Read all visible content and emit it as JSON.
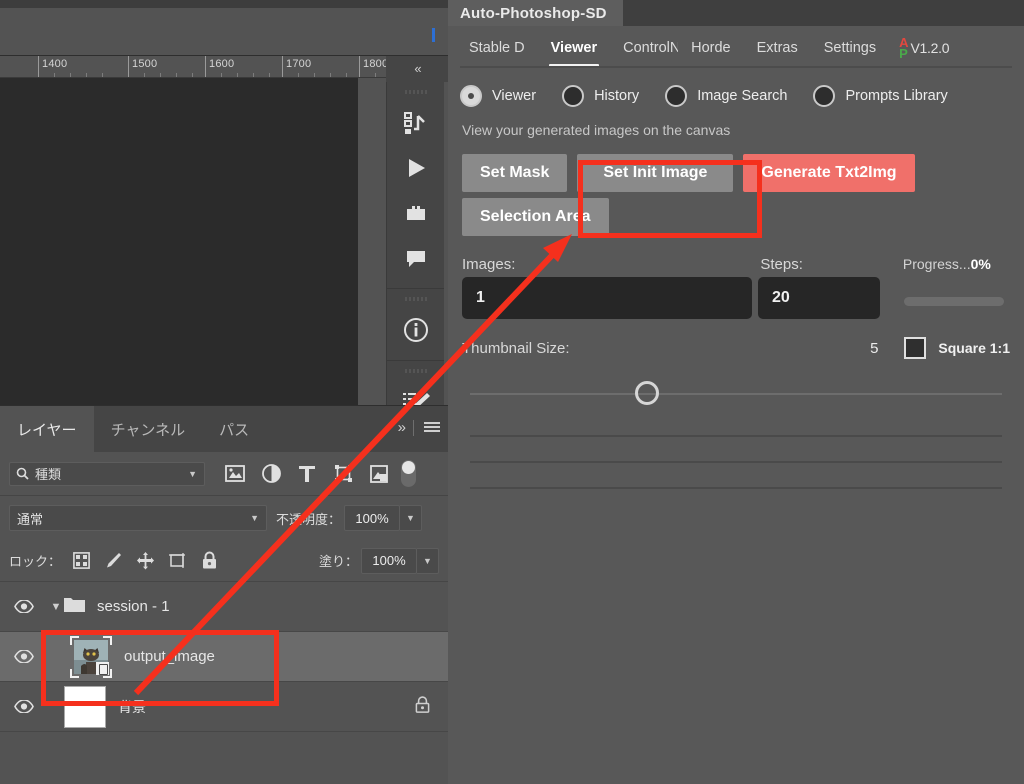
{
  "photoshop": {
    "ruler": {
      "unit_marks": [
        "1400",
        "1500",
        "1600",
        "1700",
        "1800"
      ]
    },
    "dock": {
      "collapse_icon": "double-chevron-left-icon",
      "items": [
        {
          "icon": "history-actions-icon"
        },
        {
          "icon": "play-icon"
        },
        {
          "icon": "libraries-icon"
        },
        {
          "icon": "comments-icon"
        },
        {
          "icon": "info-icon"
        },
        {
          "icon": "adjustments-brush-icon"
        },
        {
          "icon": "brush-preset-icon"
        }
      ]
    },
    "layers_panel": {
      "tabs": [
        {
          "label": "レイヤー",
          "active": true
        },
        {
          "label": "チャンネル",
          "active": false
        },
        {
          "label": "パス",
          "active": false
        }
      ],
      "overflow_icon": "double-chevron-right-icon",
      "menu_icon": "panel-menu-icon",
      "filter": {
        "search_icon": "search-icon",
        "kind_value": "種類",
        "caret_icon": "chevron-down-icon",
        "type_icons": [
          "pixel-layer-icon",
          "adjustment-layer-icon",
          "type-layer-icon",
          "shape-layer-icon",
          "smart-object-icon"
        ],
        "toggle_icon": "filter-toggle-switch"
      },
      "blend": {
        "mode_value": "通常",
        "caret_icon": "chevron-down-icon",
        "opacity_label": "不透明度：",
        "opacity_value": "100%",
        "opacity_caret_icon": "chevron-down-icon"
      },
      "lock": {
        "label": "ロック：",
        "icons": [
          "lock-transparent-pixels-icon",
          "lock-image-pixels-icon",
          "lock-position-icon",
          "lock-artboard-nesting-icon",
          "lock-all-icon"
        ],
        "fill_label": "塗り：",
        "fill_value": "100%",
        "fill_caret_icon": "chevron-down-icon"
      },
      "rows": [
        {
          "name": "session - 1",
          "type": "group",
          "selected": false,
          "eye_icon": "eye-icon",
          "caret_icon": "chevron-down-icon",
          "folder_icon": "folder-icon",
          "locked": false
        },
        {
          "name": "output_image",
          "type": "smart-object",
          "selected": true,
          "eye_icon": "eye-icon",
          "thumb": "cat-image-thumbnail",
          "locked": false
        },
        {
          "name": "背景",
          "type": "background",
          "selected": false,
          "eye_icon": "eye-icon",
          "thumb": "white-thumbnail",
          "locked": true,
          "lock_icon": "lock-icon"
        }
      ]
    }
  },
  "plugin": {
    "window_title": "Auto-Photoshop-SD",
    "tabs": [
      {
        "label": "Stable D",
        "active": false
      },
      {
        "label": "Viewer",
        "active": true
      },
      {
        "label": "ControlN",
        "active": false,
        "clipped": true
      },
      {
        "label": "Horde",
        "active": false
      },
      {
        "label": "Extras",
        "active": false
      },
      {
        "label": "Settings",
        "active": false
      }
    ],
    "logo": {
      "a": "A",
      "p": "P",
      "version": "V1.2.0"
    },
    "modes": [
      {
        "label": "Viewer",
        "selected": true
      },
      {
        "label": "History",
        "selected": false
      },
      {
        "label": "Image Search",
        "selected": false
      },
      {
        "label": "Prompts Library",
        "selected": false
      }
    ],
    "hint": "View your generated images on the canvas",
    "buttons": {
      "set_mask": "Set Mask",
      "set_init_image": "Set Init Image",
      "generate_txt2img": "Generate Txt2Img",
      "selection_area": "Selection Area"
    },
    "fields": {
      "images_label": "Images:",
      "images_value": "1",
      "steps_label": "Steps:",
      "steps_value": "20"
    },
    "progress": {
      "label": "Progress...",
      "percent": "0%"
    },
    "thumbnail": {
      "label": "Thumbnail Size:",
      "value": "5",
      "square_label": "Square 1:1",
      "square_checked": false
    }
  },
  "annotations": {
    "highlight_color": "#f5301d",
    "boxes": [
      {
        "target": "set-init-image-button"
      },
      {
        "target": "output-image-layer-row"
      }
    ],
    "arrow": {
      "from": "output-image-layer-row",
      "to": "set-init-image-button"
    }
  }
}
